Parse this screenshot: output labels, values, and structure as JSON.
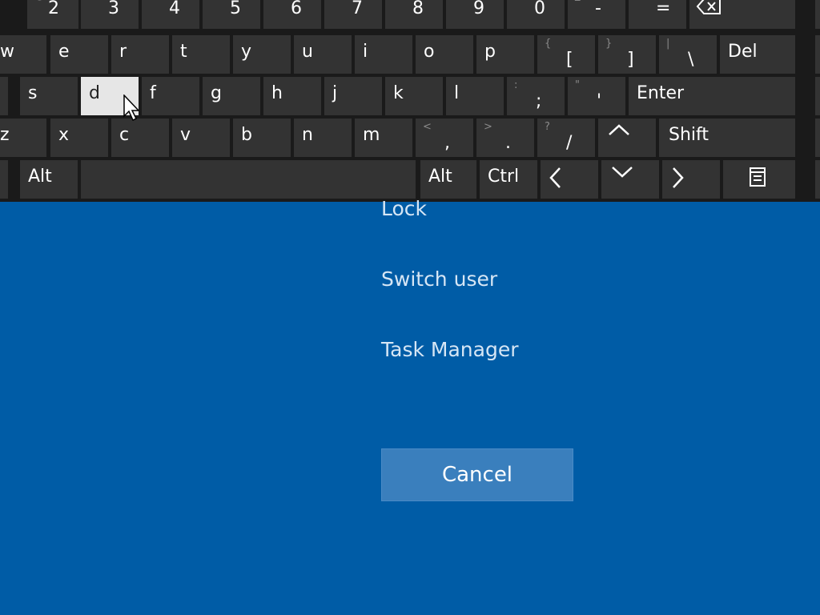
{
  "keyboard": {
    "number_row": [
      {
        "shift": "@",
        "base": "2"
      },
      {
        "shift": "#",
        "base": "3"
      },
      {
        "shift": "$",
        "base": "4"
      },
      {
        "shift": "%",
        "base": "5"
      },
      {
        "shift": "^",
        "base": "6"
      },
      {
        "shift": "&",
        "base": "7"
      },
      {
        "shift": "*",
        "base": "8"
      },
      {
        "shift": "(",
        "base": "9"
      },
      {
        "shift": ")",
        "base": "0"
      },
      {
        "shift": "_",
        "base": "-"
      },
      {
        "shift": "+",
        "base": "="
      }
    ],
    "backspace_icon": "backspace-icon",
    "q_row": [
      "w",
      "e",
      "r",
      "t",
      "y",
      "u",
      "i",
      "o",
      "p"
    ],
    "q_row_symbols": [
      {
        "shift": "{",
        "base": "["
      },
      {
        "shift": "}",
        "base": "]"
      },
      {
        "shift": "|",
        "base": "\\"
      }
    ],
    "del": "Del",
    "a_row": [
      "s",
      "d",
      "f",
      "g",
      "h",
      "j",
      "k",
      "l"
    ],
    "a_row_symbols": [
      {
        "shift": ":",
        "base": ";"
      },
      {
        "shift": "\"",
        "base": "'"
      }
    ],
    "enter": "Enter",
    "z_row": [
      "z",
      "x",
      "c",
      "v",
      "b",
      "n",
      "m"
    ],
    "z_row_symbols": [
      {
        "shift": "<",
        "base": ","
      },
      {
        "shift": ">",
        "base": "."
      },
      {
        "shift": "?",
        "base": "/"
      }
    ],
    "shift": "Shift",
    "alt_left": "Alt",
    "alt_right": "Alt",
    "ctrl": "Ctrl",
    "pressed_key": "d",
    "icons": {
      "up": "arrow-up-icon",
      "down": "arrow-down-icon",
      "left": "arrow-left-icon",
      "right": "arrow-right-icon",
      "menu": "context-menu-icon"
    }
  },
  "security_menu": {
    "items": [
      "Lock",
      "Switch user",
      "Task Manager"
    ],
    "cancel": "Cancel"
  },
  "colors": {
    "background": "#005ca6",
    "key": "#333333",
    "key_pressed": "#e6e6e6",
    "menu_text": "#d6e6f5",
    "cancel_button": "#3a7fbd"
  }
}
